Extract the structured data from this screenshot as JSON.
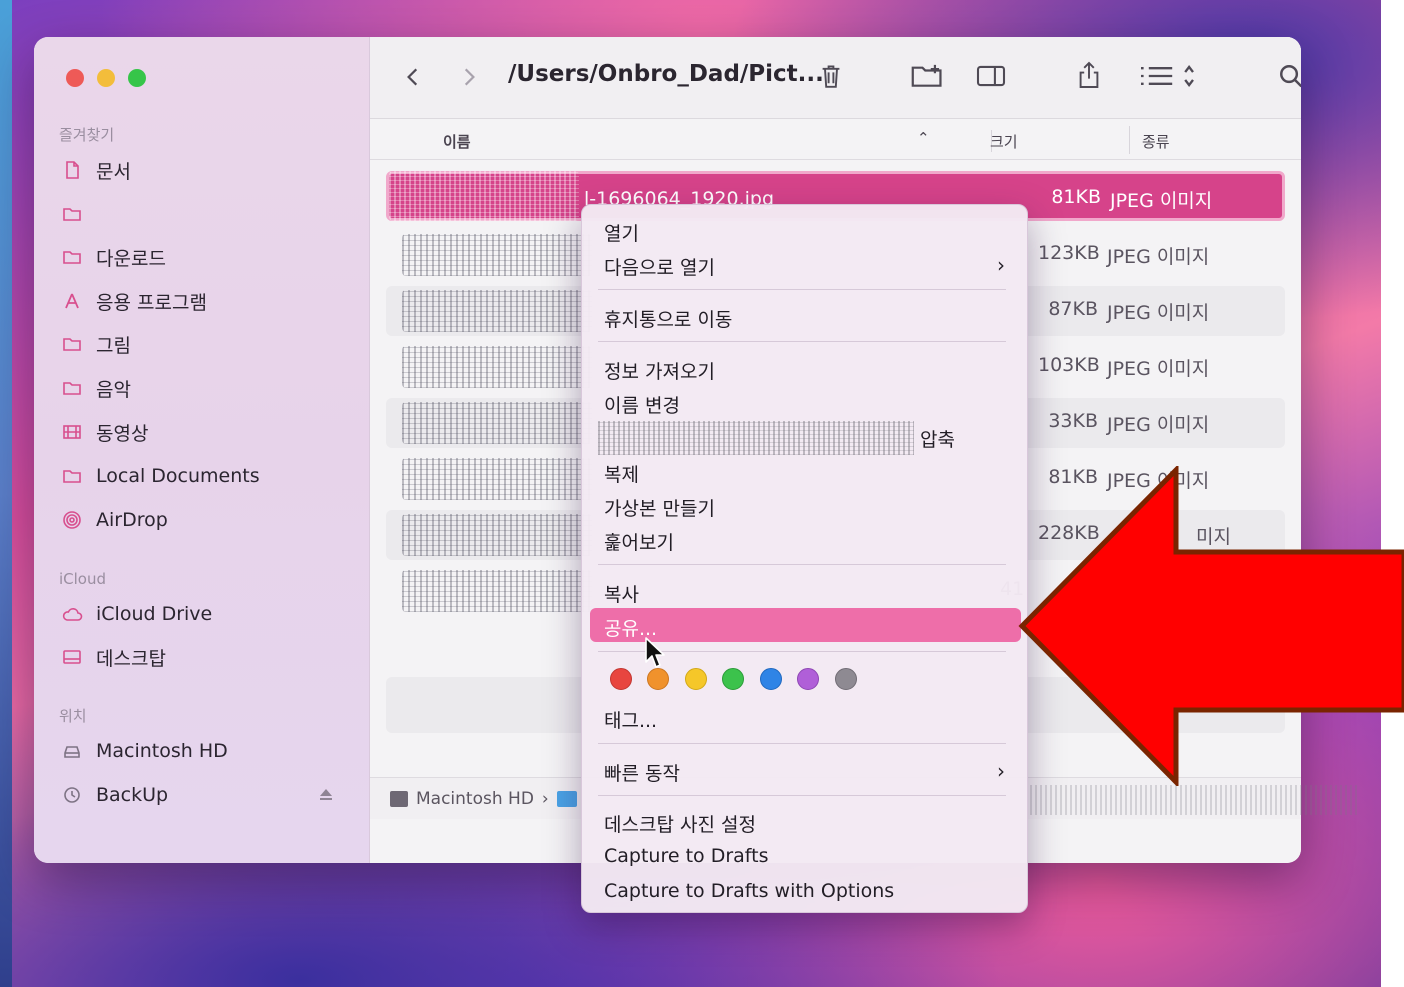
{
  "window": {
    "path_title": "/Users/Onbro_Dad/Pict...",
    "columns": {
      "name": "이름",
      "size": "크기",
      "kind": "종류"
    }
  },
  "sidebar": {
    "favorites_label": "즐겨찾기",
    "favorites": [
      {
        "label": "문서",
        "icon": "document-icon"
      },
      {
        "label": "",
        "icon": "folder-icon"
      },
      {
        "label": "다운로드",
        "icon": "folder-icon"
      },
      {
        "label": "응용 프로그램",
        "icon": "applications-icon"
      },
      {
        "label": "그림",
        "icon": "folder-icon"
      },
      {
        "label": "음악",
        "icon": "folder-icon"
      },
      {
        "label": "동영상",
        "icon": "film-icon"
      },
      {
        "label": "Local Documents",
        "icon": "folder-icon"
      },
      {
        "label": "AirDrop",
        "icon": "airdrop-icon"
      }
    ],
    "icloud_label": "iCloud",
    "icloud": [
      {
        "label": "iCloud Drive",
        "icon": "cloud-icon"
      },
      {
        "label": "데스크탑",
        "icon": "desktop-icon"
      }
    ],
    "locations_label": "위치",
    "locations": [
      {
        "label": "Macintosh HD",
        "icon": "disk-icon"
      },
      {
        "label": "BackUp",
        "icon": "time-machine-icon"
      }
    ]
  },
  "files": [
    {
      "name": "l-1696064_1920.jpg",
      "size": "81KB",
      "kind": "JPEG 이미지",
      "selected": true
    },
    {
      "size": "123KB",
      "kind": "JPEG 이미지"
    },
    {
      "size": "87KB",
      "kind": "JPEG 이미지"
    },
    {
      "size": "103KB",
      "kind": "JPEG 이미지"
    },
    {
      "size": "33KB",
      "kind": "JPEG 이미지"
    },
    {
      "size": "81KB",
      "kind": "JPEG 이미지"
    },
    {
      "size": "228KB",
      "kind": "미지"
    },
    {
      "size": "41",
      "kind": ""
    }
  ],
  "pathbar": {
    "disk": "Macintosh HD",
    "separator": "›"
  },
  "context_menu": {
    "open": "열기",
    "open_with": "다음으로 열기",
    "move_to_trash": "휴지통으로 이동",
    "get_info": "정보 가져오기",
    "rename": "이름 변경",
    "compress": "압축",
    "duplicate": "복제",
    "make_alias": "가상본 만들기",
    "quick_look": "훑어보기",
    "copy": "복사",
    "share": "공유...",
    "tags": "태그...",
    "quick_actions": "빠른 동작",
    "set_desktop_picture": "데스크탑 사진 설정",
    "capture_to_drafts": "Capture to Drafts",
    "capture_to_drafts_options": "Capture to Drafts with Options",
    "tag_colors": [
      "#e8453f",
      "#f0922c",
      "#f5c729",
      "#3cc24c",
      "#2f84e6",
      "#b05fd8",
      "#8e8a92"
    ]
  },
  "colors": {
    "accent": "#d6438a",
    "highlight": "#ee6ea9",
    "annotation_arrow": "#ff0000"
  }
}
